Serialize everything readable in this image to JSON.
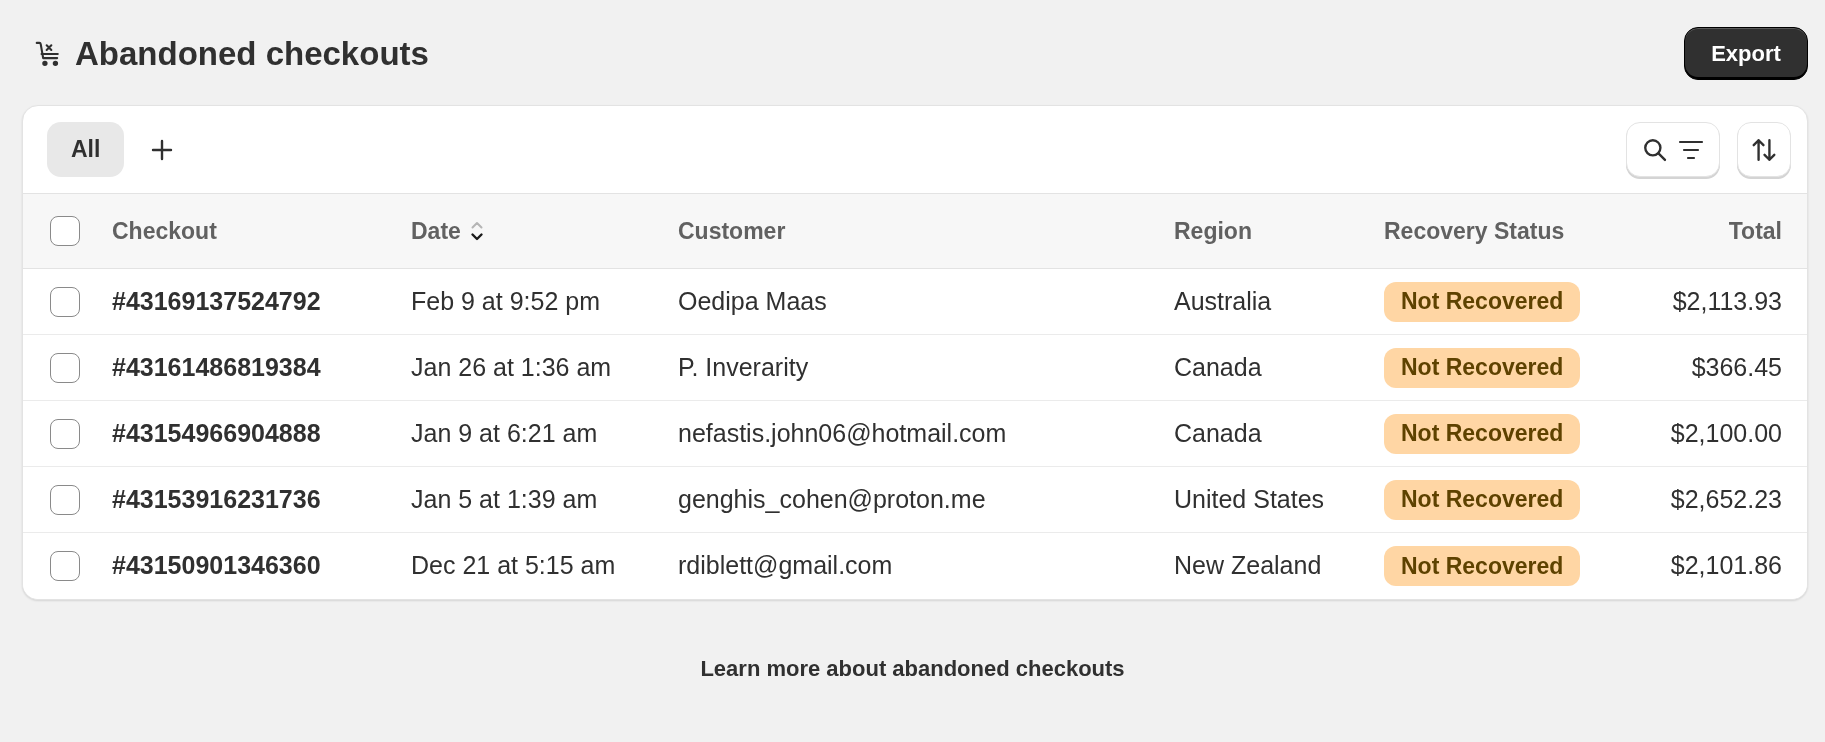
{
  "page": {
    "title": "Abandoned checkouts",
    "primary_action": "Export"
  },
  "tabs": [
    {
      "label": "All",
      "selected": true
    }
  ],
  "table": {
    "select_all_checked": false,
    "columns": [
      {
        "label": "Checkout",
        "sorted": false
      },
      {
        "label": "Date",
        "sorted": true
      },
      {
        "label": "Customer",
        "sorted": false
      },
      {
        "label": "Region",
        "sorted": false
      },
      {
        "label": "Recovery Status",
        "sorted": false
      },
      {
        "label": "Total",
        "sorted": false
      }
    ],
    "rows": [
      {
        "selected": false,
        "checkout": "#43169137524792",
        "date": "Feb 9 at 9:52 pm",
        "customer": "Oedipa Maas",
        "region": "Australia",
        "recovery_status": "Not Recovered",
        "total": "$2,113.93"
      },
      {
        "selected": false,
        "checkout": "#43161486819384",
        "date": "Jan 26 at 1:36 am",
        "customer": "P. Inverarity",
        "region": "Canada",
        "recovery_status": "Not Recovered",
        "total": "$366.45"
      },
      {
        "selected": false,
        "checkout": "#43154966904888",
        "date": "Jan 9 at 6:21 am",
        "customer": "nefastis.john06@hotmail.com",
        "region": "Canada",
        "recovery_status": "Not Recovered",
        "total": "$2,100.00"
      },
      {
        "selected": false,
        "checkout": "#43153916231736",
        "date": "Jan 5 at 1:39 am",
        "customer": "genghis_cohen@proton.me",
        "region": "United States",
        "recovery_status": "Not Recovered",
        "total": "$2,652.23"
      },
      {
        "selected": false,
        "checkout": "#43150901346360",
        "date": "Dec 21 at 5:15 am",
        "customer": "rdiblett@gmail.com",
        "region": "New Zealand",
        "recovery_status": "Not Recovered",
        "total": "$2,101.86"
      }
    ]
  },
  "footer_link": "Learn more about abandoned checkouts"
}
